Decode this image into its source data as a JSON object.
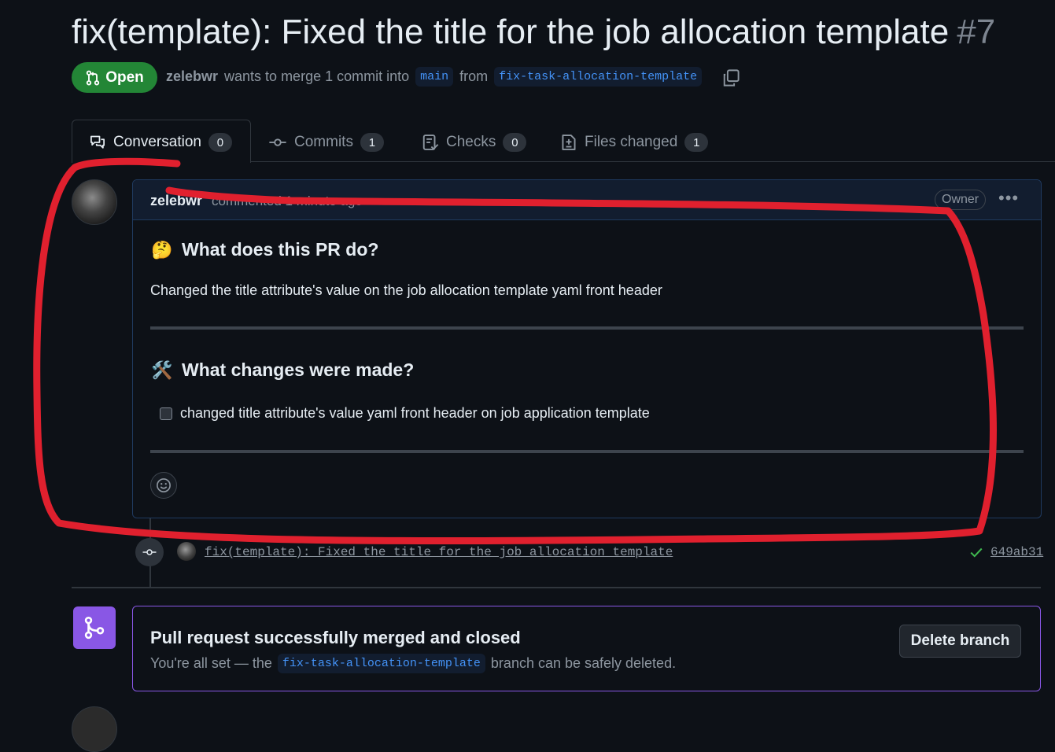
{
  "pr": {
    "title": "fix(template): Fixed the title for the job allocation template",
    "number": "#7",
    "state": "Open",
    "author": "zelebwr",
    "merge_text": "wants to merge 1 commit into",
    "base_branch": "main",
    "from_text": "from",
    "head_branch": "fix-task-allocation-template"
  },
  "tabs": [
    {
      "label": "Conversation",
      "count": "0",
      "icon": "conversation-icon"
    },
    {
      "label": "Commits",
      "count": "1",
      "icon": "commit-icon"
    },
    {
      "label": "Checks",
      "count": "0",
      "icon": "checks-icon"
    },
    {
      "label": "Files changed",
      "count": "1",
      "icon": "file-diff-icon"
    }
  ],
  "comment": {
    "author": "zelebwr",
    "time_text": "commented 1 minute ago",
    "role_badge": "Owner",
    "heading1": "What does this PR do?",
    "heading1_emoji": "🤔",
    "paragraph": "Changed the title attribute's value on the job allocation template yaml front header",
    "heading2": "What changes were made?",
    "heading2_emoji": "🛠️",
    "task_item": "changed title attribute's value yaml front header on job application template",
    "task_checked": false
  },
  "commit": {
    "message": "fix(template): Fixed the title for the job allocation template",
    "sha": "649ab31",
    "status": "success"
  },
  "merge_status": {
    "title": "Pull request successfully merged and closed",
    "desc_prefix": "You're all set — the",
    "branch": "fix-task-allocation-template",
    "desc_suffix": "branch can be safely deleted.",
    "button": "Delete branch"
  },
  "colors": {
    "open_green": "#238636",
    "merged_purple": "#8957e5",
    "link_blue": "#4493f8",
    "annotation_red": "#e0202e"
  }
}
